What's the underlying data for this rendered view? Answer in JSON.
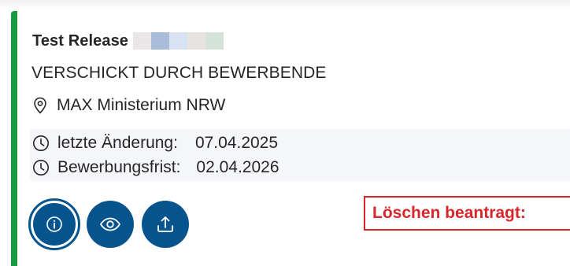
{
  "card": {
    "title": "Test Release",
    "status": "VERSCHICKT DURCH BEWERBENDE",
    "organization": "MAX Ministerium NRW",
    "last_change_label": "letzte Änderung:",
    "last_change_value": "07.04.2025",
    "deadline_label": "Bewerbungsfrist:",
    "deadline_value": "02.04.2026",
    "delete_badge": "Löschen beantragt:"
  },
  "icons": {
    "location": "location-pin-icon",
    "clock": "clock-icon",
    "info": "info-icon",
    "view": "eye-icon",
    "export": "upload-icon"
  },
  "colors": {
    "accent_green": "#1a9b3b",
    "button_blue": "#06548e",
    "delete_red": "#d9262b",
    "text": "#262626"
  }
}
